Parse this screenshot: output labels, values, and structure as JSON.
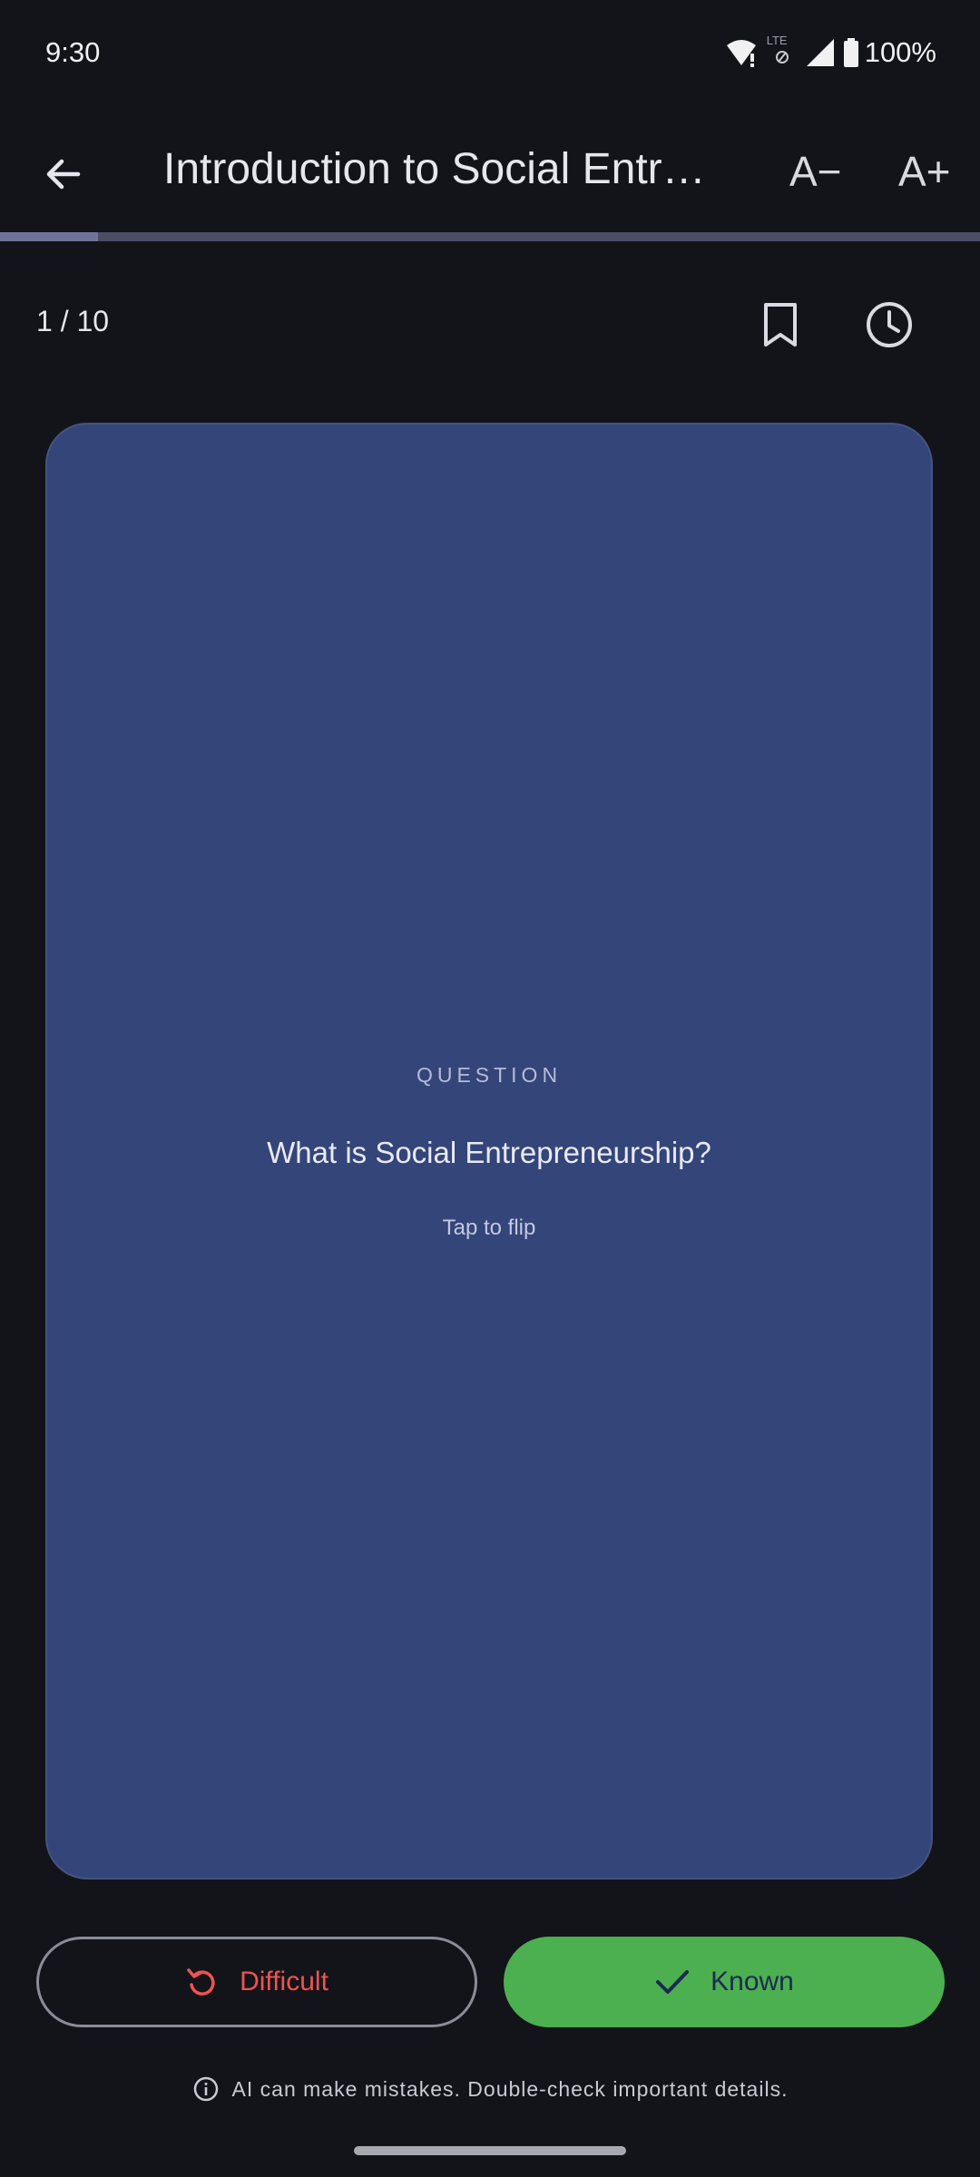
{
  "status_bar": {
    "time": "9:30",
    "network_label": "LTE",
    "battery": "100%",
    "icons": [
      "wifi-alert-icon",
      "lte-icon",
      "signal-icon",
      "battery-icon"
    ]
  },
  "app_bar": {
    "title": "Introduction to Social Entrep...",
    "font_decrease_label": "A−",
    "font_increase_label": "A+",
    "progress_fraction": 0.1
  },
  "deck": {
    "counter": "1 / 10"
  },
  "card": {
    "label": "QUESTION",
    "question": "What is Social Entrepreneurship?",
    "hint": "Tap to flip",
    "background_color": "#34457a"
  },
  "actions": {
    "difficult_label": "Difficult",
    "known_label": "Known",
    "difficult_color": "#ef5350",
    "known_color": "#4caf50"
  },
  "footer": {
    "disclaimer": "AI can make mistakes. Double-check important details."
  }
}
